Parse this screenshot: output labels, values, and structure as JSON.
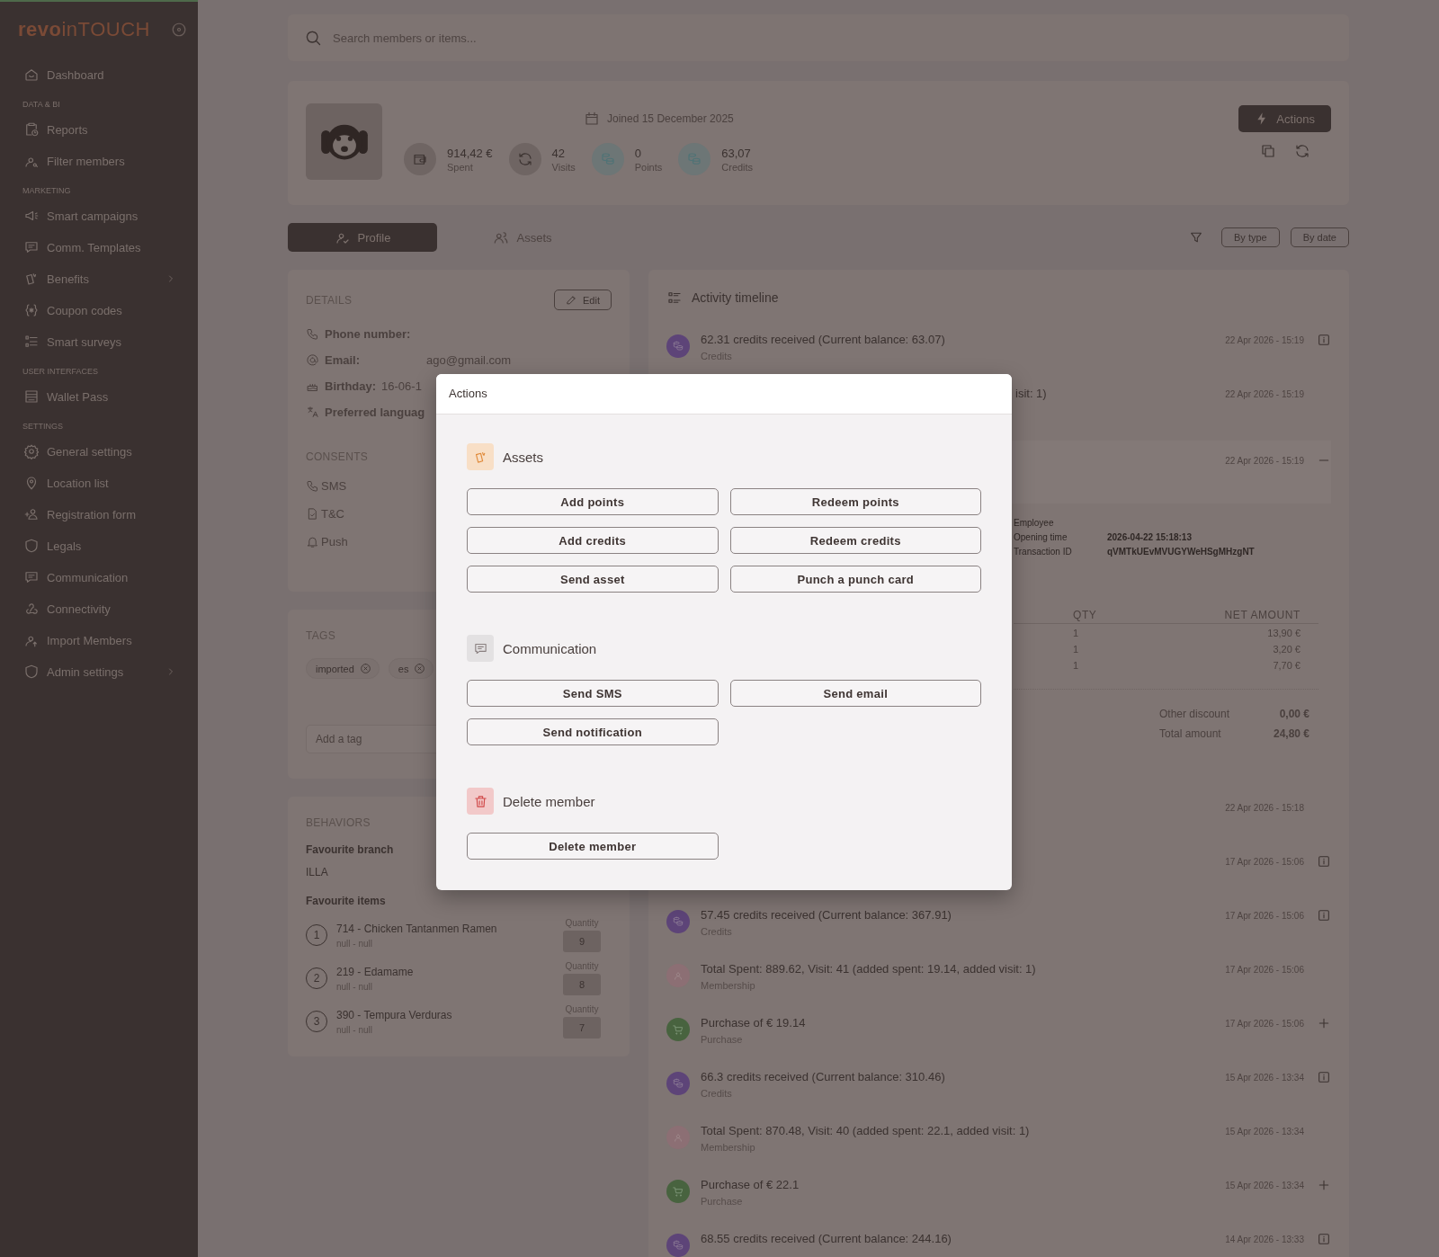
{
  "sidebar": {
    "logo": {
      "bold": "revo",
      "light": "inTOUCH"
    },
    "groups": [
      {
        "items": [
          {
            "label": "Dashboard",
            "expandable": false
          }
        ]
      },
      {
        "title": "DATA & BI",
        "items": [
          {
            "label": "Reports",
            "expandable": false
          },
          {
            "label": "Filter members",
            "expandable": false
          }
        ]
      },
      {
        "title": "MARKETING",
        "items": [
          {
            "label": "Smart campaigns",
            "expandable": false
          },
          {
            "label": "Comm. Templates",
            "expandable": false
          },
          {
            "label": "Benefits",
            "expandable": true
          },
          {
            "label": "Coupon codes",
            "expandable": false
          },
          {
            "label": "Smart surveys",
            "expandable": false
          }
        ]
      },
      {
        "title": "USER INTERFACES",
        "items": [
          {
            "label": "Wallet Pass",
            "expandable": false
          }
        ]
      },
      {
        "title": "SETTINGS",
        "items": [
          {
            "label": "General settings",
            "expandable": false
          },
          {
            "label": "Location list",
            "expandable": false
          },
          {
            "label": "Registration form",
            "expandable": false
          },
          {
            "label": "Legals",
            "expandable": false
          },
          {
            "label": "Communication",
            "expandable": false
          },
          {
            "label": "Connectivity",
            "expandable": false
          },
          {
            "label": "Import Members",
            "expandable": false
          },
          {
            "label": "Admin settings",
            "expandable": true
          }
        ]
      }
    ]
  },
  "search": {
    "placeholder": "Search members or items..."
  },
  "header": {
    "joined": "Joined 15 December 2025",
    "stats": [
      {
        "value": "914,42 €",
        "label": "Spent"
      },
      {
        "value": "42",
        "label": "Visits"
      },
      {
        "value": "0",
        "label": "Points"
      },
      {
        "value": "63,07",
        "label": "Credits"
      }
    ],
    "actions_button": "Actions"
  },
  "tabs": [
    {
      "label": "Profile",
      "selected": true
    },
    {
      "label": "Assets",
      "selected": false
    }
  ],
  "filters": [
    "By type",
    "By date"
  ],
  "details": {
    "title": "DETAILS",
    "edit_button": "Edit",
    "rows": [
      {
        "label": "Phone number:"
      },
      {
        "label": "Email:",
        "value": "ago@gmail.com"
      },
      {
        "label": "Birthday:",
        "value": "16-06-1"
      },
      {
        "label": "Preferred languag"
      }
    ],
    "consents_title": "CONSENTS",
    "consents": [
      "SMS",
      "T&C",
      "Push"
    ]
  },
  "tags": {
    "title": "TAGS",
    "items": [
      "imported",
      "es"
    ],
    "input_placeholder": "Add a tag"
  },
  "behaviors": {
    "title": "BEHAVIORS",
    "branch_label": "Favourite branch",
    "branch": "ILLA",
    "items_label": "Favourite items",
    "items": [
      {
        "rank": "1",
        "name": "714 - Chicken Tantanmen Ramen",
        "sub": "null - null",
        "quantity_label": "Quantity",
        "quantity": "9"
      },
      {
        "rank": "2",
        "name": "219 - Edamame",
        "sub": "null - null",
        "quantity_label": "Quantity",
        "quantity": "8"
      },
      {
        "rank": "3",
        "name": "390 - Tempura Verduras",
        "sub": "null - null",
        "quantity_label": "Quantity",
        "quantity": "7"
      }
    ]
  },
  "timeline": {
    "title": "Activity timeline",
    "items": [
      {
        "kind": "credits",
        "covered": false,
        "title": "62.31 credits received (Current balance: 63.07)",
        "subtitle": "Credits",
        "date": "22 Apr 2026 - 15:19",
        "info_button": true
      },
      {
        "covered": true,
        "title": "isit: 1)",
        "date": "22 Apr 2026 - 15:19"
      },
      {
        "covered": true,
        "date": "22 Apr 2026 - 15:19",
        "expanded": true,
        "details": [
          {
            "label": "Employee"
          },
          {
            "label": "Opening time",
            "value": "2026-04-22 15:18:13"
          },
          {
            "label": "Transaction ID",
            "value": "qVMTkUEvMVUGYWeHSgMHzgNT"
          }
        ],
        "columns": [
          "QTY",
          "NET AMOUNT"
        ],
        "lines": [
          {
            "qty": "1",
            "amount": "13,90 €"
          },
          {
            "qty": "1",
            "amount": "3,20 €"
          },
          {
            "qty": "1",
            "amount": "7,70 €"
          }
        ],
        "totals": [
          {
            "label": "Other discount",
            "value": "0,00 €"
          },
          {
            "label": "Total amount",
            "value": "24,80 €"
          }
        ]
      },
      {
        "date": "22 Apr 2026 - 15:18"
      },
      {
        "covered": true,
        "date": "17 Apr 2026 - 15:06",
        "info_button": true
      },
      {
        "kind": "credits",
        "covered": false,
        "title": "57.45 credits received (Current balance: 367.91)",
        "subtitle": "Credits",
        "date": "17 Apr 2026 - 15:06",
        "info_button": true
      },
      {
        "kind": "membership",
        "covered": false,
        "title": "Total Spent: 889.62, Visit: 41 (added spent: 19.14, added visit: 1)",
        "subtitle": "Membership",
        "date": "17 Apr 2026 - 15:06"
      },
      {
        "kind": "purchase",
        "covered": false,
        "title": "Purchase of € 19.14",
        "subtitle": "Purchase",
        "date": "17 Apr 2026 - 15:06",
        "expanded": false
      },
      {
        "kind": "credits",
        "covered": false,
        "title": "66.3 credits received (Current balance: 310.46)",
        "subtitle": "Credits",
        "date": "15 Apr 2026 - 13:34",
        "info_button": true
      },
      {
        "kind": "membership",
        "covered": false,
        "title": "Total Spent: 870.48, Visit: 40 (added spent: 22.1, added visit: 1)",
        "subtitle": "Membership",
        "date": "15 Apr 2026 - 13:34"
      },
      {
        "kind": "purchase",
        "covered": false,
        "title": "Purchase of € 22.1",
        "subtitle": "Purchase",
        "date": "15 Apr 2026 - 13:34",
        "expanded": false
      },
      {
        "kind": "credits",
        "covered": false,
        "title": "68.55 credits received (Current balance: 244.16)",
        "date": "14 Apr 2026 - 13:33",
        "info_button": true
      }
    ]
  },
  "modal": {
    "title": "Actions",
    "sections": [
      {
        "kind": "assets",
        "title": "Assets",
        "buttons": [
          "Add points",
          "Redeem points",
          "Add credits",
          "Redeem credits",
          "Send asset",
          "Punch a punch card"
        ]
      },
      {
        "kind": "communication",
        "title": "Communication",
        "buttons": [
          "Send SMS",
          "Send email",
          "Send notification"
        ]
      },
      {
        "kind": "danger",
        "title": "Delete member",
        "buttons": [
          "Delete member"
        ]
      }
    ]
  }
}
